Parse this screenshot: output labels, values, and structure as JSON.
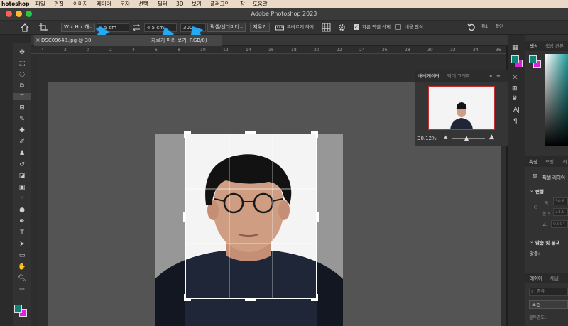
{
  "menubar": {
    "app": "hotoshop",
    "items": [
      "파일",
      "편집",
      "이미지",
      "레이어",
      "문자",
      "선택",
      "필터",
      "3D",
      "보기",
      "플러그인",
      "창",
      "도움말"
    ]
  },
  "window": {
    "title": "Adobe Photoshop 2023"
  },
  "options": {
    "ratio_select": "W x H x 해…",
    "width_value": "3.5 cm",
    "height_value": "4.5 cm",
    "resolution_value": "300",
    "unit_select": "픽셀/센티미터",
    "clear_button": "지우기",
    "straighten_label": "똑바르게 하기",
    "delete_cropped_label": "자른 픽셀 삭제",
    "content_aware_label": "내용 인식",
    "cancel_label": "취소",
    "commit_label": "확인",
    "delete_cropped_checked": true,
    "content_aware_checked": false
  },
  "document": {
    "tab_label": "DSC09648.jpg @ 30",
    "tab_label_suffix": "자르기 미리 보기, RGB/8)"
  },
  "ruler": {
    "labels": [
      "4",
      "2",
      "0",
      "2",
      "4",
      "6",
      "8",
      "10",
      "12",
      "14",
      "16",
      "18",
      "20",
      "22",
      "24",
      "26",
      "28",
      "30",
      "32",
      "34",
      "36"
    ]
  },
  "navigator": {
    "tab_navigator": "내비게이터",
    "tab_histogram": "막대 그래프",
    "zoom": "30.12%"
  },
  "right": {
    "tab_color": "색상",
    "tab_swatches": "색상 견본",
    "tab_properties": "속성",
    "tab_adjust": "조정",
    "tab_lib": "라",
    "pixel_layer": "픽셀 레이어",
    "transform": "변형",
    "w_label": "폭",
    "w_val": "50.8",
    "h_label": "높이",
    "h_val": "33.9",
    "angle_val": "0.00°",
    "align_section": "맞춤 및 분포",
    "align_label": "맞춤:",
    "tab_layers": "레이어",
    "tab_channels": "채널",
    "search_placeholder": "종류",
    "blend_mode": "표준",
    "opacity_label": "불투명도:"
  },
  "colors": {
    "accent": "#29a8f2",
    "crop_handle": "#ffffff",
    "fg_swatch": "#11847a",
    "bg_swatch": "#e020e0"
  }
}
